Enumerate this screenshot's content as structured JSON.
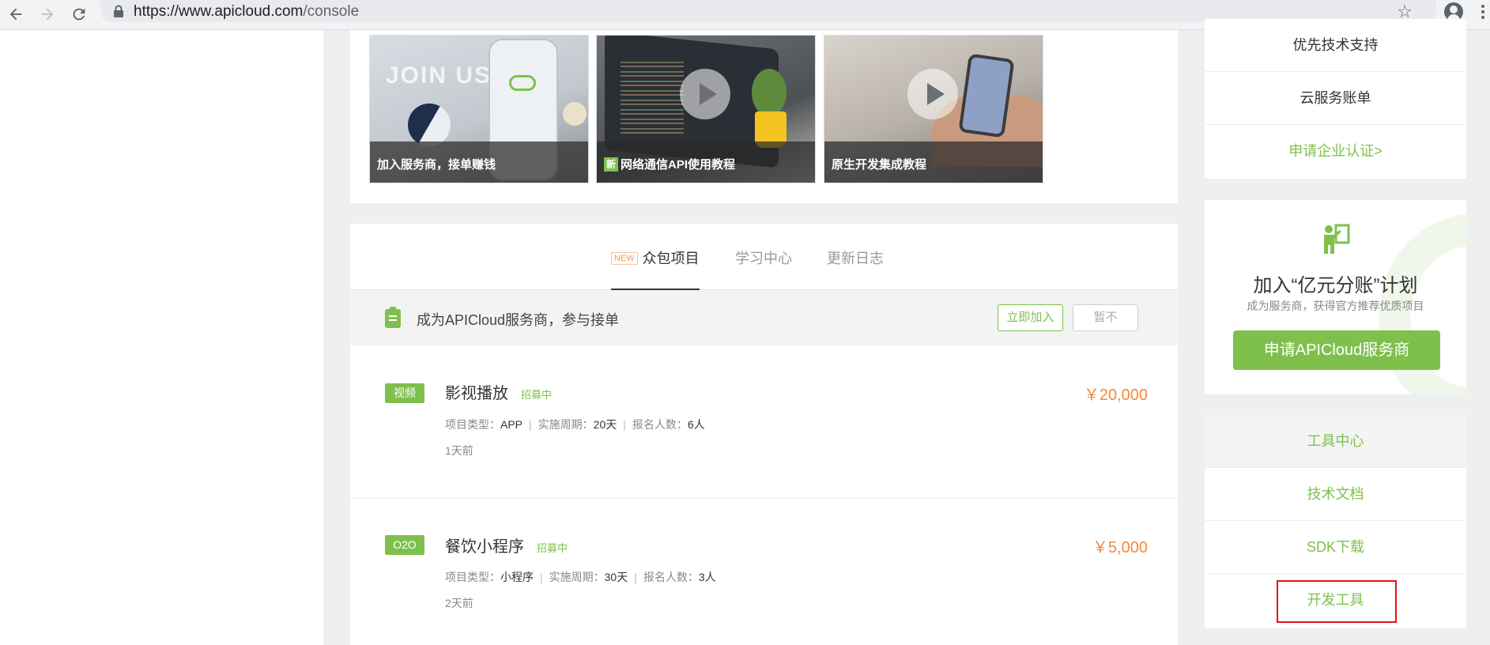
{
  "browser": {
    "url_host": "https://www.apicloud.com",
    "url_path": "/console"
  },
  "banners": [
    {
      "caption": "加入服务商，接单赚钱",
      "art_text": "JOIN US",
      "is_new": false
    },
    {
      "caption": "网络通信API使用教程",
      "is_new": true,
      "new_label": "新"
    },
    {
      "caption": "原生开发集成教程",
      "is_new": false
    }
  ],
  "tabs": {
    "new_badge": "NEW",
    "items": [
      "众包项目",
      "学习中心",
      "更新日志"
    ]
  },
  "notice": {
    "text": "成为APICloud服务商，参与接单",
    "join_label": "立即加入",
    "skip_label": "暂不"
  },
  "projects": [
    {
      "tag": "视频",
      "title": "影视播放",
      "status": "招募中",
      "type_label": "项目类型：",
      "type": "APP",
      "period_label": "实施周期：",
      "period": "20天",
      "applicants_label": "报名人数：",
      "applicants": "6人",
      "time": "1天前",
      "price": "￥20,000"
    },
    {
      "tag": "O2O",
      "title": "餐饮小程序",
      "status": "招募中",
      "type_label": "项目类型：",
      "type": "小程序",
      "period_label": "实施周期：",
      "period": "30天",
      "applicants_label": "报名人数：",
      "applicants": "3人",
      "time": "2天前",
      "price": "￥5,000"
    }
  ],
  "sidebar": {
    "top_items": [
      "优先技术支持",
      "云服务账单",
      "申请企业认证>"
    ],
    "promo": {
      "title": "加入“亿元分账”计划",
      "subtitle": "成为服务商，获得官方推荐优质项目",
      "button": "申请APICloud服务商"
    },
    "tools": [
      "工具中心",
      "技术文档",
      "SDK下载",
      "开发工具"
    ]
  },
  "colors": {
    "accent": "#7fc04d",
    "price": "#f38a3c",
    "highlight_box": "#e01515"
  }
}
